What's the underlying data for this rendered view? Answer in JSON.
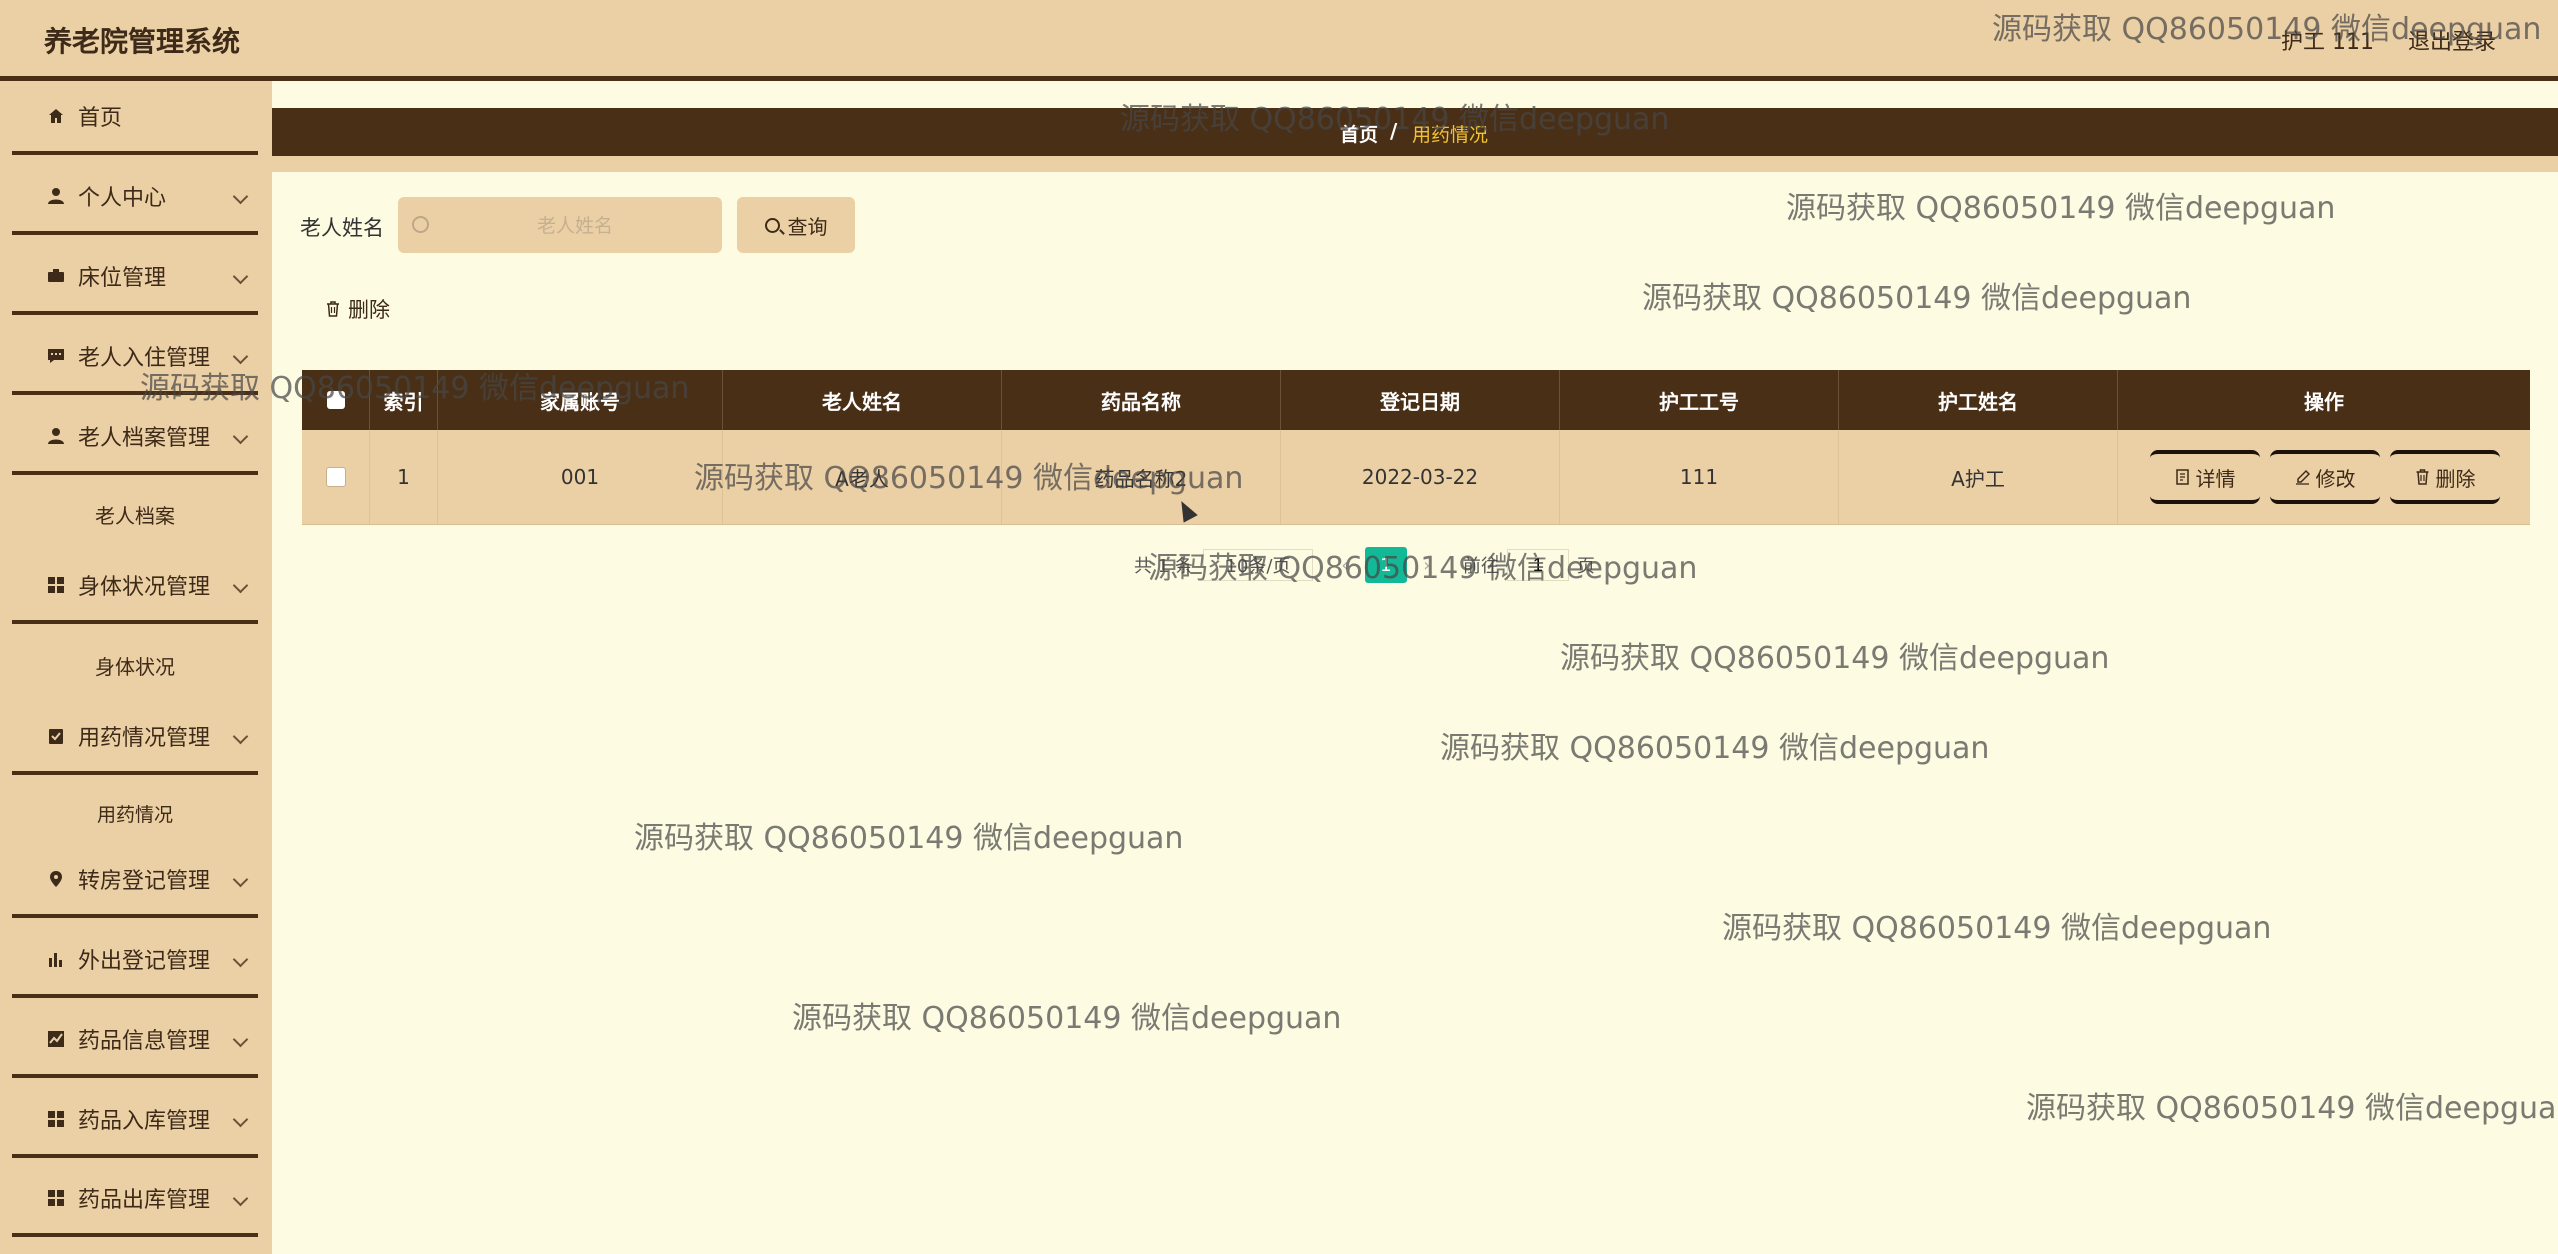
{
  "header": {
    "app_title": "养老院管理系统",
    "user": "护工 111",
    "logout": "退出登录"
  },
  "sidebar": {
    "items": [
      {
        "label": "首页",
        "icon": "home-icon",
        "expandable": false
      },
      {
        "label": "个人中心",
        "icon": "user-icon",
        "expandable": true
      },
      {
        "label": "床位管理",
        "icon": "bed-icon",
        "expandable": true
      },
      {
        "label": "老人入住管理",
        "icon": "message-icon",
        "expandable": true
      },
      {
        "label": "老人档案管理",
        "icon": "user-icon",
        "expandable": true
      },
      {
        "label": "身体状况管理",
        "icon": "grid-icon",
        "expandable": true
      },
      {
        "label": "用药情况管理",
        "icon": "clipboard-check-icon",
        "expandable": true
      },
      {
        "label": "转房登记管理",
        "icon": "location-pin-icon",
        "expandable": true
      },
      {
        "label": "外出登记管理",
        "icon": "bar-chart-icon",
        "expandable": true
      },
      {
        "label": "药品信息管理",
        "icon": "line-chart-icon",
        "expandable": true
      },
      {
        "label": "药品入库管理",
        "icon": "grid-icon",
        "expandable": true
      },
      {
        "label": "药品出库管理",
        "icon": "grid-icon",
        "expandable": true
      }
    ],
    "subitems": {
      "elder_archive": "老人档案",
      "body_status": "身体状况",
      "medication": "用药情况"
    }
  },
  "breadcrumb": {
    "home": "首页",
    "separator": "/",
    "current": "用药情况"
  },
  "search": {
    "label": "老人姓名",
    "placeholder": "老人姓名",
    "value": "",
    "query_button": "查询"
  },
  "toolbar": {
    "delete_label": "删除"
  },
  "table": {
    "columns": [
      "索引",
      "家属账号",
      "老人姓名",
      "药品名称",
      "登记日期",
      "护工工号",
      "护工姓名",
      "操作"
    ],
    "rows": [
      {
        "index": "1",
        "family_account": "001",
        "elder_name": "A老人",
        "drug_name": "药品名称2",
        "date": "2022-03-22",
        "nurse_id": "111",
        "nurse_name": "A护工"
      }
    ],
    "actions": {
      "detail": "详情",
      "edit": "修改",
      "delete": "删除"
    }
  },
  "pagination": {
    "total_text": "共 1 条",
    "page_size": "10条/页",
    "current_page": "1",
    "goto_label": "前往",
    "goto_value": "1",
    "unit": "页",
    "accent": "#13b896"
  },
  "watermark": {
    "text": "源码获取 QQ86050149 微信deepguan"
  },
  "colors": {
    "background": "#fdfbe2",
    "panel": "#ecd0a5",
    "dark_brown": "#4a2f17",
    "breadcrumb_current": "#f4c430"
  }
}
